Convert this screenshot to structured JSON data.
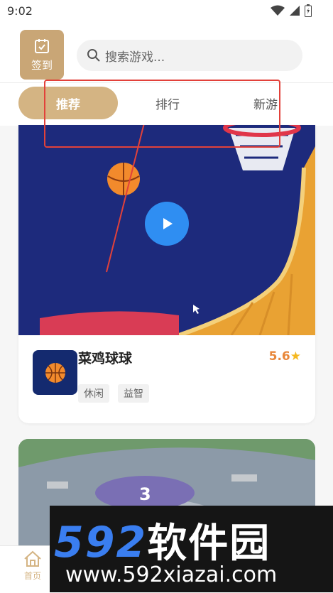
{
  "status_bar": {
    "time": "9:02",
    "icons": [
      "wifi-icon",
      "signal-icon",
      "battery-icon"
    ]
  },
  "header": {
    "signin_label": "签到",
    "search_placeholder": "搜索游戏..."
  },
  "tabs": [
    {
      "label": "推荐",
      "active": true
    },
    {
      "label": "排行",
      "active": false
    },
    {
      "label": "新游",
      "active": false
    }
  ],
  "game_card": {
    "name": "菜鸡球球",
    "rating": "5.6",
    "rating_star": "★",
    "tags": [
      "休闲",
      "益智"
    ]
  },
  "bottom_nav": {
    "home_label": "首页"
  },
  "watermark": {
    "brand_digits": "592",
    "brand_cn": "软件园",
    "url": "www.592xiazai.com"
  },
  "colors": {
    "accent": "#d4b483",
    "signin_bg": "#c9a676",
    "annotation_red": "#e2413a",
    "play_blue": "#2f8ef2",
    "rating_orange": "#e8873a"
  }
}
